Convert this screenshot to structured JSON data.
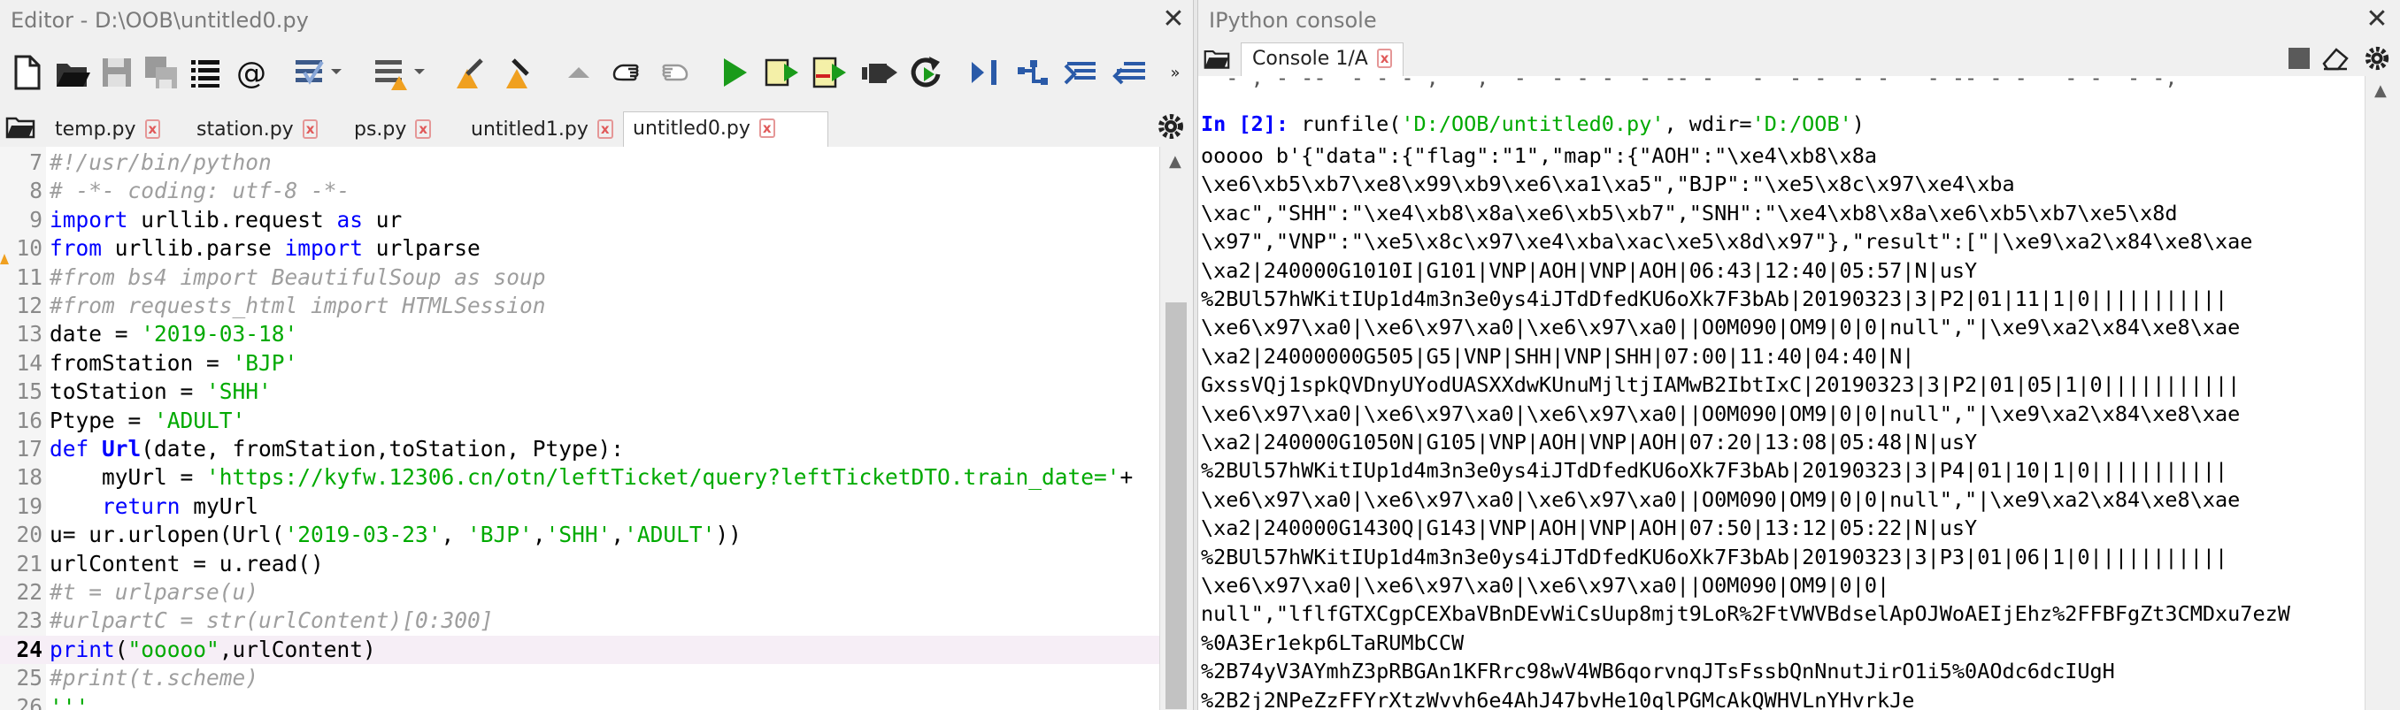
{
  "editor": {
    "title": "Editor - D:\\OOB\\untitled0.py",
    "close_label": "✕",
    "tabs": [
      {
        "label": "temp.py",
        "close": "x"
      },
      {
        "label": "station.py",
        "close": "x"
      },
      {
        "label": "ps.py",
        "close": "x"
      },
      {
        "label": "untitled1.py",
        "close": "x"
      },
      {
        "label": "untitled0.py",
        "close": "x",
        "active": true
      }
    ],
    "code_lines": [
      {
        "n": "7",
        "segs": [
          [
            "cm",
            "#!/usr/bin/python"
          ]
        ]
      },
      {
        "n": "8",
        "segs": [
          [
            "cm",
            "# -*- coding: utf-8 -*-"
          ]
        ]
      },
      {
        "n": "9",
        "segs": [
          [
            "kw",
            "import"
          ],
          [
            "nm",
            " urllib.request "
          ],
          [
            "kw",
            "as"
          ],
          [
            "nm",
            " ur"
          ]
        ]
      },
      {
        "n": "10",
        "warn": true,
        "segs": [
          [
            "kw",
            "from"
          ],
          [
            "nm",
            " urllib.parse "
          ],
          [
            "kw",
            "import"
          ],
          [
            "nm",
            " urlparse"
          ]
        ]
      },
      {
        "n": "11",
        "segs": [
          [
            "cm",
            "#from bs4 import BeautifulSoup as soup"
          ]
        ]
      },
      {
        "n": "12",
        "segs": [
          [
            "cm",
            "#from requests_html import HTMLSession"
          ]
        ]
      },
      {
        "n": "13",
        "segs": [
          [
            "nm",
            "date = "
          ],
          [
            "st",
            "'2019-03-18'"
          ]
        ]
      },
      {
        "n": "14",
        "segs": [
          [
            "nm",
            "fromStation = "
          ],
          [
            "st",
            "'BJP'"
          ]
        ]
      },
      {
        "n": "15",
        "segs": [
          [
            "nm",
            "toStation = "
          ],
          [
            "st",
            "'SHH'"
          ]
        ]
      },
      {
        "n": "16",
        "segs": [
          [
            "nm",
            "Ptype = "
          ],
          [
            "st",
            "'ADULT'"
          ]
        ]
      },
      {
        "n": "17",
        "segs": [
          [
            "kw",
            "def"
          ],
          [
            "nm",
            " "
          ],
          [
            "kb",
            "Url"
          ],
          [
            "nm",
            "(date, fromStation,toStation, Ptype):"
          ]
        ]
      },
      {
        "n": "18",
        "segs": [
          [
            "nm",
            "    myUrl = "
          ],
          [
            "st",
            "'https://kyfw.12306.cn/otn/leftTicket/query?leftTicketDTO.train_date='"
          ],
          [
            "nm",
            "+"
          ]
        ]
      },
      {
        "n": "19",
        "segs": [
          [
            "nm",
            "    "
          ],
          [
            "kw",
            "return"
          ],
          [
            "nm",
            " myUrl"
          ]
        ]
      },
      {
        "n": "20",
        "segs": [
          [
            "nm",
            "u= ur.urlopen(Url("
          ],
          [
            "st",
            "'2019-03-23'"
          ],
          [
            "nm",
            ", "
          ],
          [
            "st",
            "'BJP'"
          ],
          [
            "nm",
            ","
          ],
          [
            "st",
            "'SHH'"
          ],
          [
            "nm",
            ","
          ],
          [
            "st",
            "'ADULT'"
          ],
          [
            "nm",
            "))"
          ]
        ]
      },
      {
        "n": "21",
        "segs": [
          [
            "nm",
            "urlContent = u.read()"
          ]
        ]
      },
      {
        "n": "22",
        "segs": [
          [
            "cm",
            "#t = urlparse(u)"
          ]
        ]
      },
      {
        "n": "23",
        "segs": [
          [
            "cm",
            "#urlpartC = str(urlContent)[0:300]"
          ]
        ]
      },
      {
        "n": "24",
        "current": true,
        "segs": [
          [
            "kw",
            "print"
          ],
          [
            "nm",
            "("
          ],
          [
            "st",
            "\"ooooo\""
          ],
          [
            "nm",
            ",urlContent)"
          ]
        ]
      },
      {
        "n": "25",
        "segs": [
          [
            "cm",
            "#print(t.scheme)"
          ]
        ]
      },
      {
        "n": "26",
        "segs": [
          [
            "st",
            "'''"
          ]
        ]
      }
    ]
  },
  "console": {
    "title": "IPython console",
    "tab_label": "Console 1/A",
    "tab_close": "x",
    "prompt_in": "In [2]:",
    "run_cmd_pre": " runfile(",
    "run_arg1": "'D:/OOB/untitled0.py'",
    "run_mid": ", wdir=",
    "run_arg2": "'D:/OOB'",
    "run_end": ")",
    "output_lines": [
      "ooooo b'{\"data\":{\"flag\":\"1\",\"map\":{\"AOH\":\"\\xe4\\xb8\\x8a",
      "\\xe6\\xb5\\xb7\\xe8\\x99\\xb9\\xe6\\xa1\\xa5\",\"BJP\":\"\\xe5\\x8c\\x97\\xe4\\xba",
      "\\xac\",\"SHH\":\"\\xe4\\xb8\\x8a\\xe6\\xb5\\xb7\",\"SNH\":\"\\xe4\\xb8\\x8a\\xe6\\xb5\\xb7\\xe5\\x8d",
      "\\x97\",\"VNP\":\"\\xe5\\x8c\\x97\\xe4\\xba\\xac\\xe5\\x8d\\x97\"},\"result\":[\"|\\xe9\\xa2\\x84\\xe8\\xae",
      "\\xa2|240000G1010I|G101|VNP|AOH|VNP|AOH|06:43|12:40|05:57|N|usY",
      "%2BUl57hWKitIUp1d4m3n3e0ys4iJTdDfedKU6oXk7F3bAb|20190323|3|P2|01|11|1|0|||||||||||",
      "\\xe6\\x97\\xa0|\\xe6\\x97\\xa0|\\xe6\\x97\\xa0||O0M090|OM9|0|0|null\",\"|\\xe9\\xa2\\x84\\xe8\\xae",
      "\\xa2|24000000G505|G5|VNP|SHH|VNP|SHH|07:00|11:40|04:40|N|",
      "GxssVQj1spkQVDnyUYodUASXXdwKUnuMjltjIAMwB2IbtIxC|20190323|3|P2|01|05|1|0|||||||||||",
      "\\xe6\\x97\\xa0|\\xe6\\x97\\xa0|\\xe6\\x97\\xa0||O0M090|OM9|0|0|null\",\"|\\xe9\\xa2\\x84\\xe8\\xae",
      "\\xa2|240000G1050N|G105|VNP|AOH|VNP|AOH|07:20|13:08|05:48|N|usY",
      "%2BUl57hWKitIUp1d4m3n3e0ys4iJTdDfedKU6oXk7F3bAb|20190323|3|P4|01|10|1|0|||||||||||",
      "\\xe6\\x97\\xa0|\\xe6\\x97\\xa0|\\xe6\\x97\\xa0||O0M090|OM9|0|0|null\",\"|\\xe9\\xa2\\x84\\xe8\\xae",
      "\\xa2|240000G1430Q|G143|VNP|AOH|VNP|AOH|07:50|13:12|05:22|N|usY",
      "%2BUl57hWKitIUp1d4m3n3e0ys4iJTdDfedKU6oXk7F3bAb|20190323|3|P3|01|06|1|0|||||||||||",
      "\\xe6\\x97\\xa0|\\xe6\\x97\\xa0|\\xe6\\x97\\xa0||O0M090|OM9|0|0|",
      "null\",\"lflfGTXCgpCEXbaVBnDEvWiCsUup8mjt9LoR%2FtVWVBdselApOJWoAEIjEhz%2FFBFgZt3CMDxu7ezW",
      "%0A3Er1ekp6LTaRUMbCCW",
      "%2B74yV3AYmhZ3pRBGAn1KFRrc98wV4WB6qorvnqJTsFssbQnNnutJirO1i5%0AOdc6dcIUgH",
      "%2B2j2NPeZzFFYrXtzWvvh6e4AhJ47bvHe10qlPGMcAkQWHVLnYHvrkJe"
    ]
  },
  "colors": {
    "keyword": "#0000ff",
    "string": "#00aa00",
    "comment": "#9e9e9e",
    "tab_close": "#e05a5a",
    "run_green": "#1a9b1a"
  },
  "icons": [
    "new-file-icon",
    "open-folder-icon",
    "save-icon",
    "save-all-icon",
    "list-icon",
    "at-sign-icon",
    "todo-icon",
    "warning-list-icon",
    "warning-prev-icon",
    "warning-next-icon",
    "prev-cursor-icon",
    "back-hand-icon",
    "forward-hand-icon",
    "run-icon",
    "run-cell-icon",
    "run-cell-advance-icon",
    "run-selection-icon",
    "rerun-icon",
    "debug-step-icon",
    "debug-icon",
    "debug-up-icon",
    "debug-down-icon",
    "more-icon"
  ]
}
